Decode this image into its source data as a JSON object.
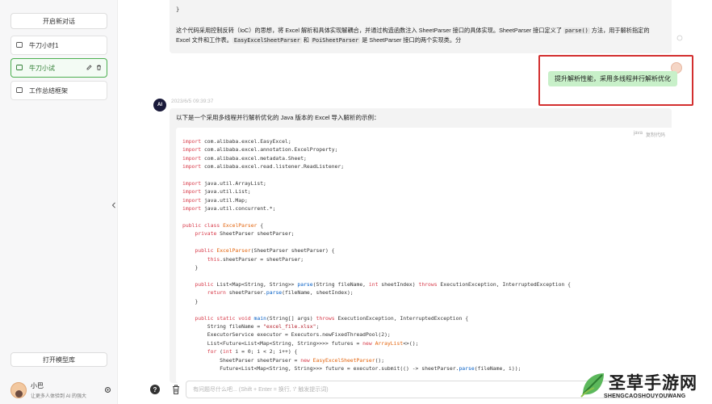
{
  "sidebar": {
    "new_chat": "开启新对话",
    "conversations": [
      {
        "title": "牛刀小时1"
      },
      {
        "title": "牛刀小试"
      },
      {
        "title": "工作总结框架"
      }
    ],
    "model_library": "打开模型库",
    "user": {
      "name": "小巴",
      "subtitle": "让更多人体验到 AI 的强大"
    }
  },
  "previous_message": {
    "brace": "}",
    "text_1": "这个代码采用控制反转（IoC）的思想，将 Excel 解析和具体实现解耦合，并通过构造函数注入 SheetParser 接口的具体实现。SheetParser 接口定义了 ",
    "code_1": "parse()",
    "text_2": " 方法，用于解析指定的 Excel 文件和工作表。",
    "code_2": "EasyExcelSheetParser",
    "text_3": " 和 ",
    "code_3": "PoiSheetParser",
    "text_4": " 是 SheetParser 接口的两个实现类。分"
  },
  "user_message": {
    "text": "提升解析性能，采用多线程并行解析优化"
  },
  "ai_message": {
    "time": "2023/6/5 09:39:37",
    "avatar_label": "AI",
    "intro": "以下是一个采用多线程并行解析优化的 Java 版本的 Excel 导入解析的示例：",
    "code_lang": "java",
    "code_copy": "复制代码",
    "code_lines": [
      "import com.alibaba.excel.EasyExcel;",
      "import com.alibaba.excel.annotation.ExcelProperty;",
      "import com.alibaba.excel.metadata.Sheet;",
      "import com.alibaba.excel.read.listener.ReadListener;",
      "",
      "import java.util.ArrayList;",
      "import java.util.List;",
      "import java.util.Map;",
      "import java.util.concurrent.*;",
      "",
      "public class ExcelParser {",
      "    private SheetParser sheetParser;",
      "",
      "    public ExcelParser(SheetParser sheetParser) {",
      "        this.sheetParser = sheetParser;",
      "    }",
      "",
      "    public List<Map<String, String>> parse(String fileName, int sheetIndex) throws ExecutionException, InterruptedException {",
      "        return sheetParser.parse(fileName, sheetIndex);",
      "    }",
      "",
      "    public static void main(String[] args) throws ExecutionException, InterruptedException {",
      "        String fileName = \"excel_file.xlsx\";",
      "        ExecutorService executor = Executors.newFixedThreadPool(2);",
      "        List<Future<List<Map<String, String>>>> futures = new ArrayList<>();",
      "        for (int i = 0; i < 2; i++) {",
      "            SheetParser sheetParser = new EasyExcelSheetParser();",
      "            Future<List<Map<String, String>>> future = executor.submit(() -> sheetParser.parse(fileName, i));"
    ]
  },
  "input": {
    "placeholder": "有问题尽什么吧... (Shift + Enter = 换行, '/' 触发提示词)"
  },
  "watermark": {
    "cn": "圣草手游网",
    "en": "SHENGCAOSHOUYOUWANG"
  },
  "colors": {
    "accent_green": "#4caf50",
    "user_bubble": "#c8f0c9",
    "highlight_box": "#d32f2f"
  }
}
